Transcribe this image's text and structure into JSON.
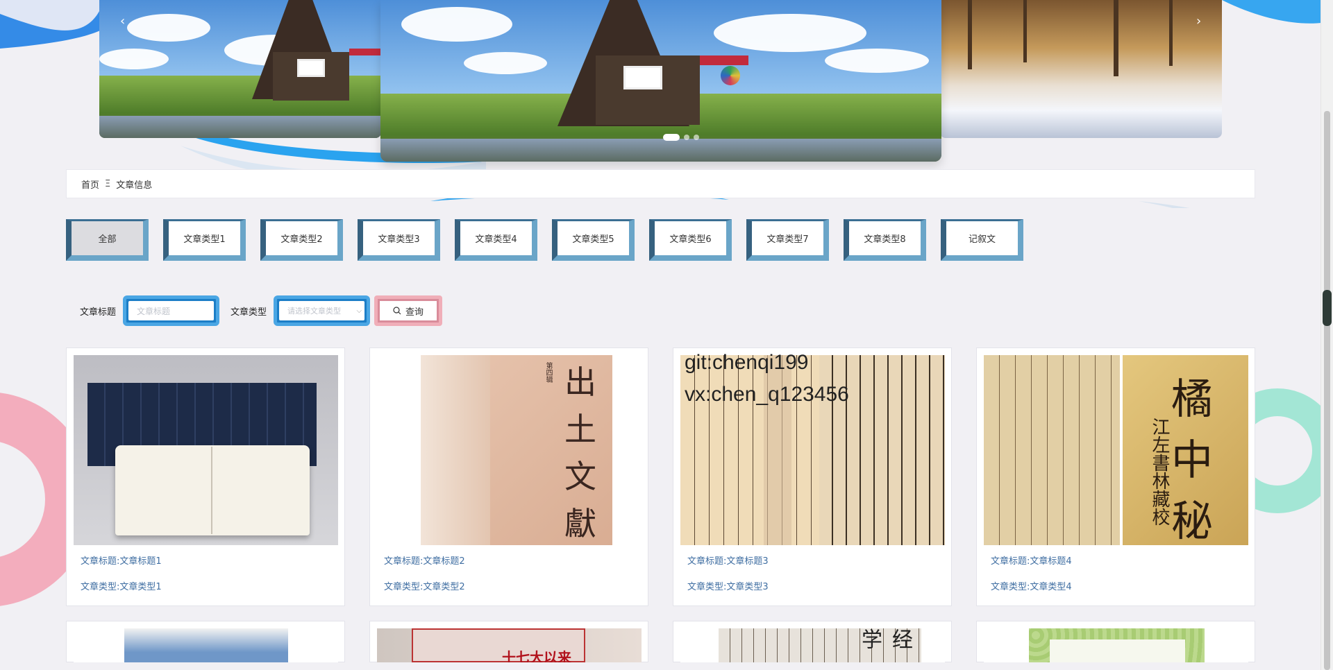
{
  "carousel": {
    "prev": "‹",
    "next": "›"
  },
  "breadcrumb": {
    "home": "首页",
    "separator": "Ξ",
    "current": "文章信息"
  },
  "types": [
    "全部",
    "文章类型1",
    "文章类型2",
    "文章类型3",
    "文章类型4",
    "文章类型5",
    "文章类型6",
    "文章类型7",
    "文章类型8",
    "记叙文"
  ],
  "search": {
    "title_label": "文章标题",
    "title_placeholder": "文章标题",
    "type_label": "文章类型",
    "type_placeholder": "请选择文章类型",
    "query_label": "查询"
  },
  "watermark": {
    "line1": "git:chenqi199",
    "line2": "vx:chen_q123456"
  },
  "articles": [
    {
      "title": "文章标题:文章标题1",
      "type": "文章类型:文章类型1"
    },
    {
      "title": "文章标题:文章标题2",
      "type": "文章类型:文章类型2"
    },
    {
      "title": "文章标题:文章标题3",
      "type": "文章类型:文章类型3"
    },
    {
      "title": "文章标题:文章标题4",
      "type": "文章类型:文章类型4"
    }
  ],
  "cover_text": {
    "card2": [
      "出",
      "土",
      "文",
      "獻"
    ],
    "card2_side": "第四辑",
    "card4": [
      "橘",
      "中",
      "秘"
    ],
    "card4_side": "江左書林藏校",
    "card6": "十七大以来",
    "card8": "经学"
  },
  "colors": {
    "link": "#3f6ea2",
    "type_btn_dark": "#2a4d6c",
    "type_btn_light": "#6aa5c8",
    "input_border": "#4aa6e4",
    "query_border": "#f0aeb8"
  }
}
